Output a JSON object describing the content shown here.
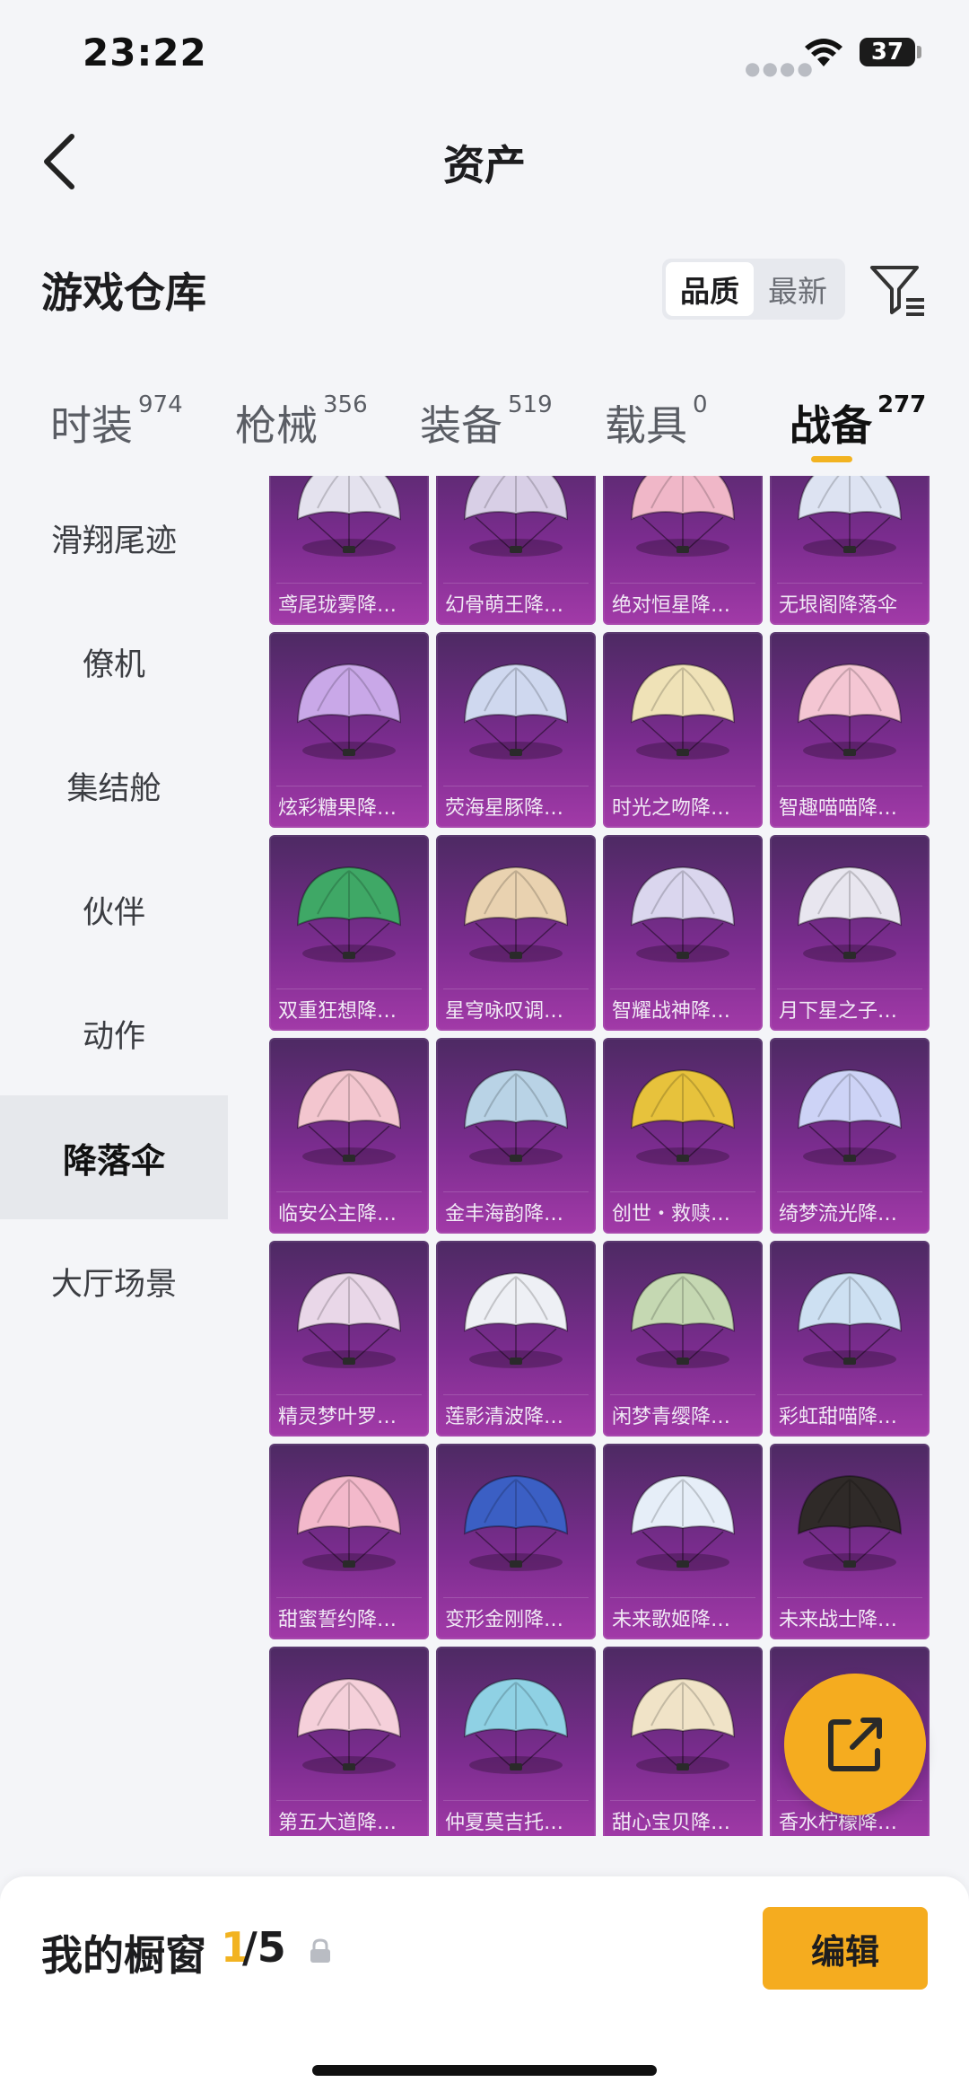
{
  "status_bar": {
    "time": "23:22",
    "battery": "37"
  },
  "header": {
    "title": "资产"
  },
  "section": {
    "title": "游戏仓库"
  },
  "sort": {
    "options": [
      "品质",
      "最新"
    ],
    "active": "品质"
  },
  "tabs": [
    {
      "label": "时装",
      "count": "974"
    },
    {
      "label": "枪械",
      "count": "356"
    },
    {
      "label": "装备",
      "count": "519"
    },
    {
      "label": "载具",
      "count": "0"
    },
    {
      "label": "战备",
      "count": "277"
    }
  ],
  "active_tab": "战备",
  "sidebar": {
    "items": [
      "滑翔尾迹",
      "僚机",
      "集结舱",
      "伙伴",
      "动作",
      "降落伞",
      "大厅场景"
    ],
    "active": "降落伞"
  },
  "grid": {
    "items": [
      "鸢尾珑雾降…",
      "幻骨萌王降…",
      "绝对恒星降…",
      "无垠阁降落伞",
      "炫彩糖果降…",
      "荧海星豚降…",
      "时光之吻降…",
      "智趣喵喵降…",
      "双重狂想降…",
      "星穹咏叹调…",
      "智耀战神降…",
      "月下星之子…",
      "临安公主降…",
      "金丰海韵降…",
      "创世・救赎…",
      "绮梦流光降…",
      "精灵梦叶罗…",
      "莲影清波降…",
      "闲梦青缨降…",
      "彩虹甜喵降…",
      "甜蜜誓约降…",
      "变形金刚降…",
      "未来歌姬降…",
      "未来战士降…",
      "第五大道降…",
      "仲夏莫吉托…",
      "甜心宝贝降…",
      "香水柠檬降…"
    ],
    "canopy_colors": [
      "#e4e2ee",
      "#d8cfe6",
      "#f0b7c8",
      "#dde3f2",
      "#c9a8e8",
      "#cfd8ef",
      "#efe2b7",
      "#f4c6d3",
      "#3fa866",
      "#e9d2b0",
      "#dad6ee",
      "#e8e6ef",
      "#f3c6cf",
      "#b9d3e6",
      "#e7c23c",
      "#cdd3f6",
      "#e9d7e8",
      "#eef0f5",
      "#c5d8b2",
      "#cde0f2",
      "#f3b9cb",
      "#3b5fc4",
      "#e6eef8",
      "#2f2a28",
      "#f5d0da",
      "#8fd1e4",
      "#f0e3c7",
      "#f6d45a"
    ]
  },
  "showcase": {
    "label": "我的橱窗",
    "current": "1",
    "total": "/5"
  },
  "edit_button": "编辑"
}
